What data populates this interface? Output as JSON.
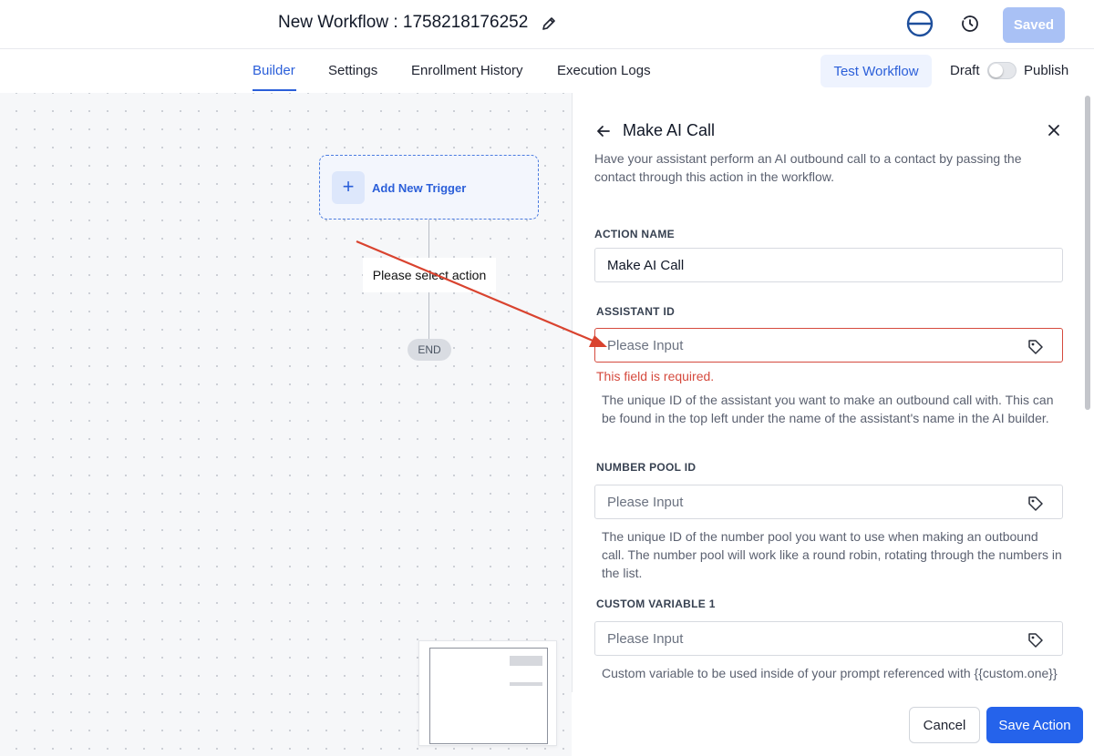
{
  "header": {
    "title": "New Workflow : 1758218176252",
    "saved_label": "Saved"
  },
  "tabs": [
    {
      "label": "Builder",
      "active": true
    },
    {
      "label": "Settings"
    },
    {
      "label": "Enrollment History"
    },
    {
      "label": "Execution Logs"
    }
  ],
  "toolbar": {
    "test_label": "Test Workflow",
    "draft_label": "Draft",
    "publish_label": "Publish",
    "publish_on": false
  },
  "canvas": {
    "trigger_label": "Add New Trigger",
    "action_label": "Please select action",
    "end_label": "END"
  },
  "panel": {
    "title": "Make AI Call",
    "description": "Have your assistant perform an AI outbound call to a contact by passing the contact through this action in the workflow.",
    "fields": {
      "action_name": {
        "label": "ACTION NAME",
        "value": "Make AI Call"
      },
      "assistant_id": {
        "label": "ASSISTANT ID",
        "placeholder": "Please Input",
        "error": "This field is required.",
        "help": "The unique ID of the assistant you want to make an outbound call with. This can be found in the top left under the name of the assistant's name in the AI builder."
      },
      "number_pool_id": {
        "label": "NUMBER POOL ID",
        "placeholder": "Please Input",
        "help": "The unique ID of the number pool you want to use when making an outbound call. The number pool will work like a round robin, rotating through the numbers in the list."
      },
      "custom_variable_1": {
        "label": "CUSTOM VARIABLE 1",
        "placeholder": "Please Input",
        "help": "Custom variable to be used inside of your prompt referenced with {{custom.one}}"
      }
    }
  },
  "footer": {
    "cancel_label": "Cancel",
    "save_label": "Save Action"
  },
  "colors": {
    "accent": "#2563eb",
    "error": "#d54a3e",
    "annotation_arrow": "#d9432f"
  },
  "icons": [
    "edit-icon",
    "logo-icon",
    "history-icon",
    "plus-icon",
    "back-arrow-icon",
    "close-icon",
    "tag-icon"
  ]
}
